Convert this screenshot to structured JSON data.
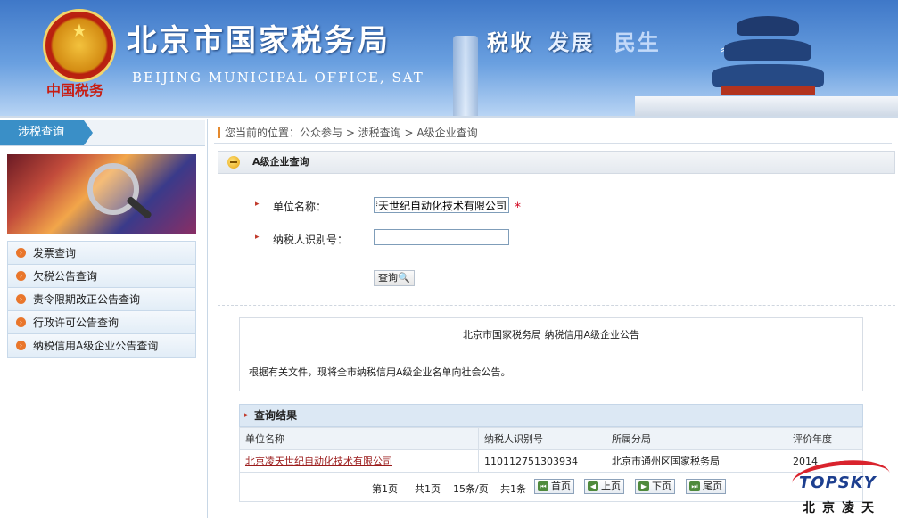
{
  "banner": {
    "title_cn": "北京市国家税务局",
    "title_en": "BEIJING MUNICIPAL OFFICE, SAT",
    "calligraphy": "中国税务",
    "slogan1": "税收",
    "slogan2": "发展",
    "slogan3": "民生"
  },
  "sidebar": {
    "tab": "涉税查询",
    "items": [
      {
        "label": "发票查询"
      },
      {
        "label": "欠税公告查询"
      },
      {
        "label": "责令限期改正公告查询"
      },
      {
        "label": "行政许可公告查询"
      },
      {
        "label": "纳税信用A级企业公告查询"
      }
    ]
  },
  "breadcrumb": "您当前的位置：公众参与 > 涉税查询 > A级企业查询",
  "panel_title": "A级企业查询",
  "form": {
    "company_label": "单位名称：",
    "company_value": "北京凌天世纪自动化技术有限公司",
    "taxid_label": "纳税人识别号：",
    "taxid_value": "",
    "required_mark": "*",
    "query_button": "查询🔍"
  },
  "notice": {
    "title": "北京市国家税务局 纳税信用A级企业公告",
    "body": "根据有关文件，现将全市纳税信用A级企业名单向社会公告。"
  },
  "results": {
    "title": "查询结果",
    "columns": [
      "单位名称",
      "纳税人识别号",
      "所属分局",
      "评价年度"
    ],
    "rows": [
      [
        "北京凌天世纪自动化技术有限公司",
        "110112751303934",
        "北京市通州区国家税务局",
        "2014"
      ]
    ]
  },
  "pager": {
    "page": "第1页",
    "total_pages": "共1页",
    "per_page": "15条/页",
    "total_items": "共1条",
    "first": "首页",
    "prev": "上页",
    "next": "下页",
    "last": "尾页"
  },
  "logo": {
    "brand": "TOPSKY",
    "cn": "北京凌天"
  }
}
